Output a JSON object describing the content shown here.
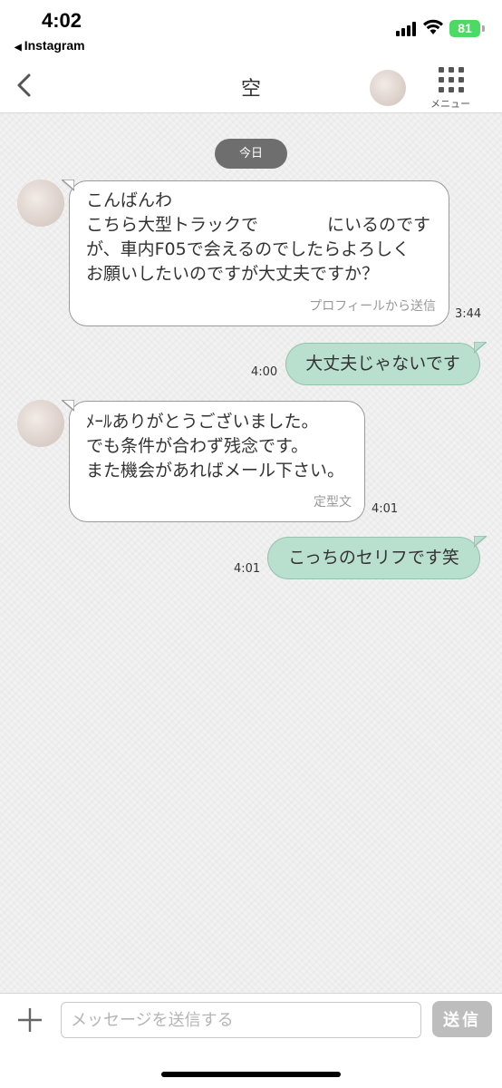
{
  "status_bar": {
    "time": "4:02",
    "back_app": "Instagram",
    "battery": "81"
  },
  "nav": {
    "title": "空",
    "menu_label": "メニュー",
    "back_icon": "chevron-left-icon",
    "menu_icon": "grid-icon"
  },
  "chat": {
    "date_label": "今日",
    "messages": [
      {
        "side": "in",
        "text": "こんばんわ\nこちら大型トラックで　　　　にいるのです\nが、車内F05で会えるのでしたらよろしく\nお願いしたいのですが大丈夫ですか？",
        "sub": "プロフィールから送信",
        "time": "3:44"
      },
      {
        "side": "out",
        "text": "大丈夫じゃないです",
        "time": "4:00"
      },
      {
        "side": "in",
        "text": "ﾒｰﾙありがとうございました。\nでも条件が合わず残念です。\nまた機会があればメール下さい。",
        "sub": "定型文",
        "time": "4:01"
      },
      {
        "side": "out",
        "text": "こっちのセリフです笑",
        "time": "4:01"
      }
    ]
  },
  "input": {
    "placeholder": "メッセージを送信する",
    "send_label": "送信",
    "plus_icon": "plus-icon"
  },
  "colors": {
    "outgoing_bubble": "#b9dfcf",
    "incoming_bubble": "#ffffff",
    "date_pill": "#6e6e6e",
    "send_button": "#bdbdbd",
    "battery": "#4cd964"
  }
}
